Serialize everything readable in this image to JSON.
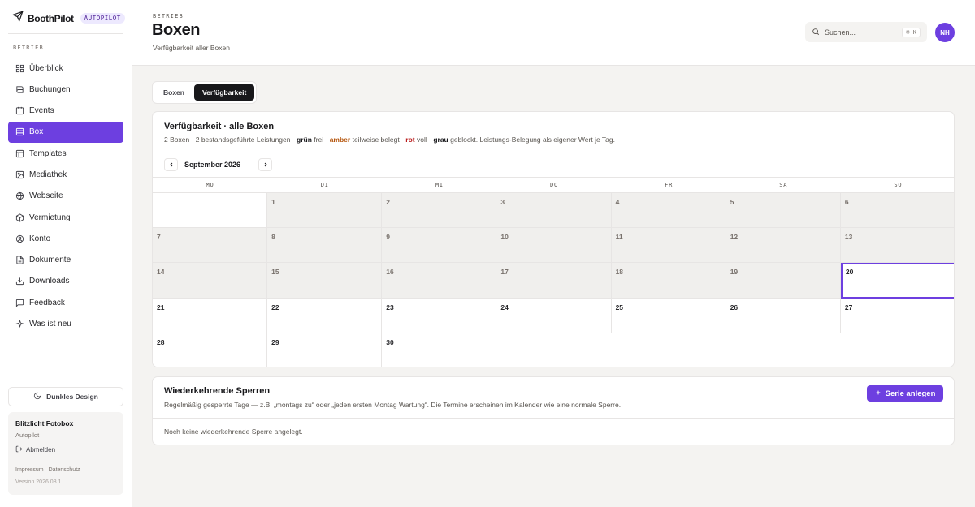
{
  "brand": {
    "name": "BoothPilot",
    "badge": "AUTOPILOT"
  },
  "sidebar": {
    "section": "BETRIEB",
    "items": [
      {
        "label": "Überblick",
        "icon": "grid-icon"
      },
      {
        "label": "Buchungen",
        "icon": "book-icon"
      },
      {
        "label": "Events",
        "icon": "calendar-icon"
      },
      {
        "label": "Box",
        "icon": "box-icon",
        "active": true
      },
      {
        "label": "Templates",
        "icon": "layout-icon"
      },
      {
        "label": "Mediathek",
        "icon": "image-icon"
      },
      {
        "label": "Webseite",
        "icon": "globe-icon"
      },
      {
        "label": "Vermietung",
        "icon": "package-icon"
      },
      {
        "label": "Konto",
        "icon": "user-icon"
      },
      {
        "label": "Dokumente",
        "icon": "file-icon"
      },
      {
        "label": "Downloads",
        "icon": "download-icon"
      },
      {
        "label": "Feedback",
        "icon": "message-icon"
      },
      {
        "label": "Was ist neu",
        "icon": "sparkle-icon"
      }
    ],
    "dark_mode_label": "Dunkles Design",
    "account": {
      "name": "Blitzlicht Fotobox",
      "plan": "Autopilot",
      "logout": "Abmelden",
      "links": [
        "Impressum",
        "Datenschutz"
      ],
      "version": "Version 2026.08.1"
    }
  },
  "header": {
    "eyebrow": "BETRIEB",
    "title": "Boxen",
    "subtitle": "Verfügbarkeit aller Boxen",
    "search_placeholder": "Suchen...",
    "search_shortcut": "⌘ K",
    "avatar_initials": "NH"
  },
  "tabs": [
    {
      "label": "Boxen",
      "active": false
    },
    {
      "label": "Verfügbarkeit",
      "active": true
    }
  ],
  "availability": {
    "title": "Verfügbarkeit · alle Boxen",
    "desc": {
      "prefix": "2 Boxen · 2 bestandsgeführte Leistungen ·",
      "green": "grün",
      "green_text": "frei ·",
      "amber": "amber",
      "amber_text": "teilweise belegt ·",
      "red": "rot",
      "red_text": "voll ·",
      "gray": "grau",
      "gray_text": "geblockt. Leistungs-Belegung als eigener Wert je Tag."
    },
    "month": "September 2026",
    "weekdays": [
      "MO",
      "DI",
      "MI",
      "DO",
      "FR",
      "SA",
      "SO"
    ],
    "first_weekday_index": 1,
    "days_in_month": 30,
    "today": 20,
    "colors": {
      "accent": "#6d3fe0",
      "past_bg": "#f0efed"
    }
  },
  "recurring": {
    "title": "Wiederkehrende Sperren",
    "desc": "Regelmäßig gesperrte Tage — z.B. „montags zu“ oder „jeden ersten Montag Wartung“. Die Termine erscheinen im Kalender wie eine normale Sperre.",
    "button_label": "Serie anlegen",
    "empty": "Noch keine wiederkehrende Sperre angelegt."
  }
}
